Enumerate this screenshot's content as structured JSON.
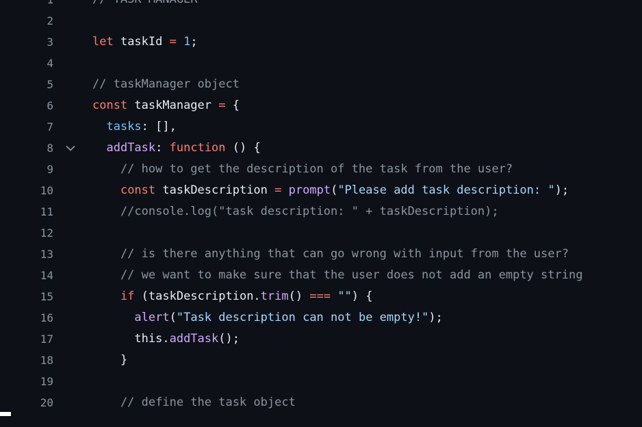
{
  "editor": {
    "lines": [
      {
        "num": "1",
        "segments": [
          {
            "t": "// TASK MANAGER",
            "c": "cmt"
          }
        ]
      },
      {
        "num": "2",
        "segments": []
      },
      {
        "num": "3",
        "segments": [
          {
            "t": "let",
            "c": "kw"
          },
          {
            "t": " taskId ",
            "c": "plain"
          },
          {
            "t": "=",
            "c": "kw"
          },
          {
            "t": " ",
            "c": "plain"
          },
          {
            "t": "1",
            "c": "num"
          },
          {
            "t": ";",
            "c": "plain"
          }
        ]
      },
      {
        "num": "4",
        "segments": []
      },
      {
        "num": "5",
        "segments": [
          {
            "t": "// taskManager object",
            "c": "cmt"
          }
        ]
      },
      {
        "num": "6",
        "segments": [
          {
            "t": "const",
            "c": "kw"
          },
          {
            "t": " taskManager ",
            "c": "plain"
          },
          {
            "t": "=",
            "c": "kw"
          },
          {
            "t": " {",
            "c": "plain"
          }
        ]
      },
      {
        "num": "7",
        "segments": [
          {
            "t": "  ",
            "c": "plain"
          },
          {
            "t": "tasks",
            "c": "prop"
          },
          {
            "t": ": [],",
            "c": "plain"
          }
        ]
      },
      {
        "num": "8",
        "fold": true,
        "segments": [
          {
            "t": "  ",
            "c": "plain"
          },
          {
            "t": "addTask",
            "c": "fn"
          },
          {
            "t": ": ",
            "c": "plain"
          },
          {
            "t": "function",
            "c": "kw"
          },
          {
            "t": " () {",
            "c": "plain"
          }
        ]
      },
      {
        "num": "9",
        "segments": [
          {
            "t": "    // how to get the description of the task from the user?",
            "c": "cmt"
          }
        ]
      },
      {
        "num": "10",
        "segments": [
          {
            "t": "    ",
            "c": "plain"
          },
          {
            "t": "const",
            "c": "kw"
          },
          {
            "t": " taskDescription ",
            "c": "plain"
          },
          {
            "t": "=",
            "c": "kw"
          },
          {
            "t": " ",
            "c": "plain"
          },
          {
            "t": "prompt",
            "c": "fn"
          },
          {
            "t": "(",
            "c": "plain"
          },
          {
            "t": "\"Please add task description: \"",
            "c": "str"
          },
          {
            "t": ");",
            "c": "plain"
          }
        ]
      },
      {
        "num": "11",
        "segments": [
          {
            "t": "    //console.log(\"task description: \" + taskDescription);",
            "c": "cmt"
          }
        ]
      },
      {
        "num": "12",
        "segments": []
      },
      {
        "num": "13",
        "segments": [
          {
            "t": "    // is there anything that can go wrong with input from the user?",
            "c": "cmt"
          }
        ]
      },
      {
        "num": "14",
        "segments": [
          {
            "t": "    // we want to make sure that the user does not add an empty string",
            "c": "cmt"
          }
        ]
      },
      {
        "num": "15",
        "segments": [
          {
            "t": "    ",
            "c": "plain"
          },
          {
            "t": "if",
            "c": "kw"
          },
          {
            "t": " (taskDescription.",
            "c": "plain"
          },
          {
            "t": "trim",
            "c": "fn"
          },
          {
            "t": "() ",
            "c": "plain"
          },
          {
            "t": "===",
            "c": "kw"
          },
          {
            "t": " ",
            "c": "plain"
          },
          {
            "t": "\"\"",
            "c": "str"
          },
          {
            "t": ") {",
            "c": "plain"
          }
        ]
      },
      {
        "num": "16",
        "segments": [
          {
            "t": "      ",
            "c": "plain"
          },
          {
            "t": "alert",
            "c": "fn"
          },
          {
            "t": "(",
            "c": "plain"
          },
          {
            "t": "\"Task description can not be empty!\"",
            "c": "str"
          },
          {
            "t": ");",
            "c": "plain"
          }
        ]
      },
      {
        "num": "17",
        "segments": [
          {
            "t": "      this.",
            "c": "plain"
          },
          {
            "t": "addTask",
            "c": "fn"
          },
          {
            "t": "();",
            "c": "plain"
          }
        ]
      },
      {
        "num": "18",
        "segments": [
          {
            "t": "    }",
            "c": "plain"
          }
        ]
      },
      {
        "num": "19",
        "segments": []
      },
      {
        "num": "20",
        "segments": [
          {
            "t": "    // define the task object",
            "c": "cmt"
          }
        ]
      }
    ]
  },
  "colors": {
    "background": "#0d1117",
    "keyword": "#ff7b72",
    "function": "#d2a8ff",
    "string": "#a5d6ff",
    "number": "#79c0ff",
    "comment": "#8b949e",
    "text": "#e6edf3"
  },
  "icons": {
    "fold": "chevron-down-icon"
  }
}
